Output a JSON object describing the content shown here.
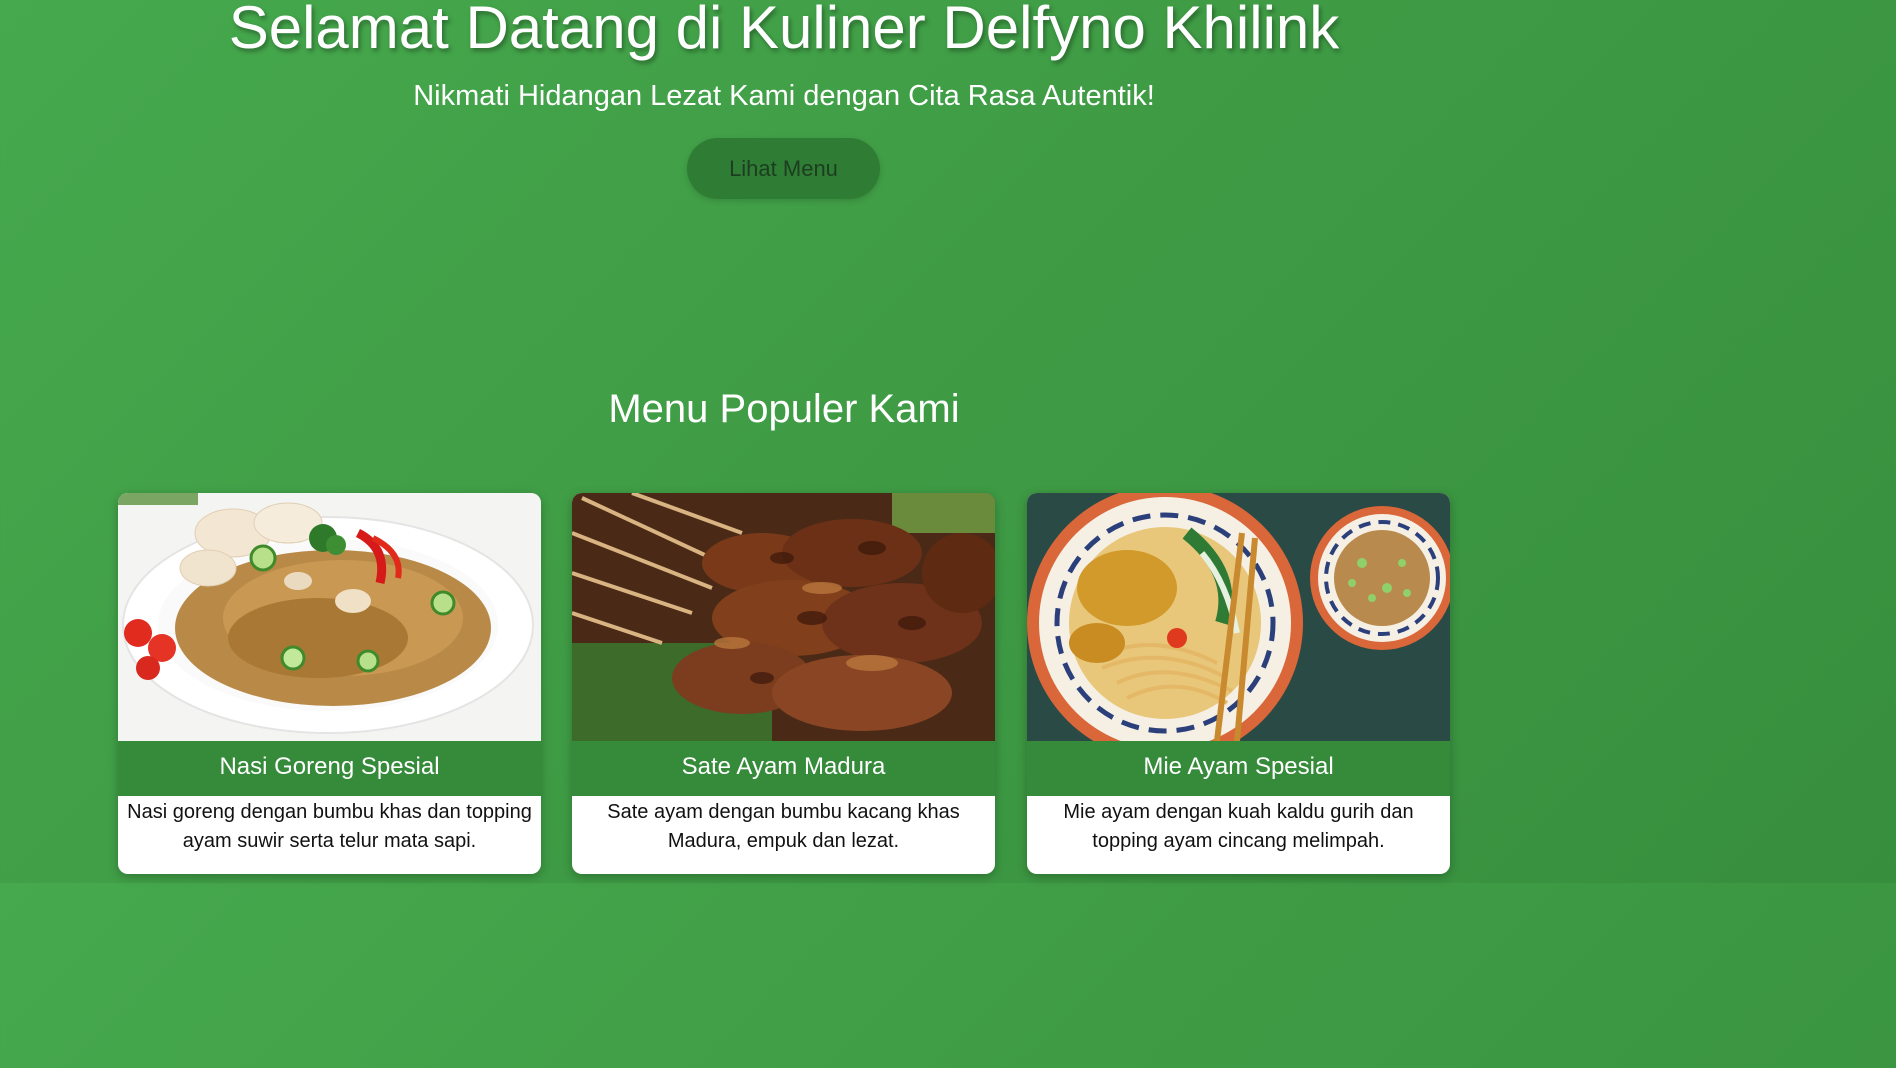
{
  "hero": {
    "title": "Selamat Datang di Kuliner Delfyno Khilink",
    "subtitle": "Nikmati Hidangan Lezat Kami dengan Cita Rasa Autentik!",
    "cta_label": "Lihat Menu"
  },
  "menu": {
    "heading": "Menu Populer Kami",
    "items": [
      {
        "name": "Nasi Goreng Spesial",
        "description": "Nasi goreng dengan bumbu khas dan topping ayam suwir serta telur mata sapi."
      },
      {
        "name": "Sate Ayam Madura",
        "description": "Sate ayam dengan bumbu kacang khas Madura, empuk dan lezat."
      },
      {
        "name": "Mie Ayam Spesial",
        "description": "Mie ayam dengan kuah kaldu gurih dan topping ayam cincang melimpah."
      }
    ]
  },
  "colors": {
    "background": "#40a046",
    "card_title_bar": "#368b3b",
    "button": "#2f7d35"
  }
}
